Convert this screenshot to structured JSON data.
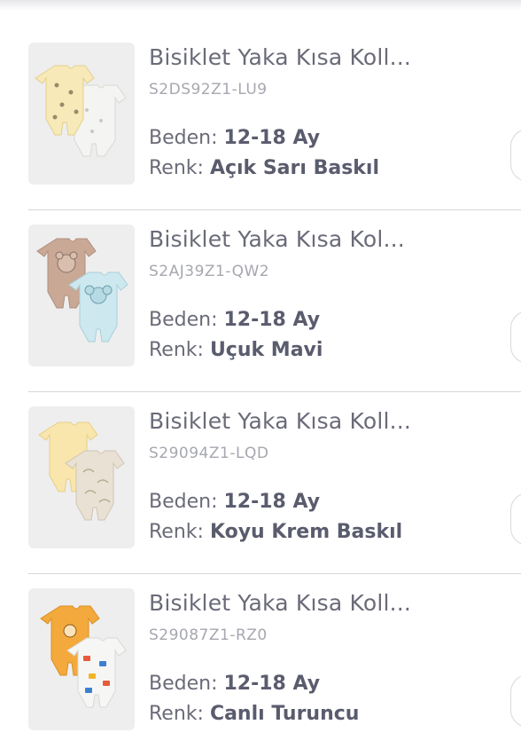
{
  "items": [
    {
      "title": "Bisiklet Yaka Kısa Koll...",
      "code": "S2DS92Z1-LU9",
      "size_label": "Beden:",
      "size_value": "12-18 Ay",
      "color_label": "Renk:",
      "color_value": "Açık Sarı Baskıl",
      "image": "romper-set-yellow-print-icon"
    },
    {
      "title": "Bisiklet Yaka Kısa Kol...",
      "code": "S2AJ39Z1-QW2",
      "size_label": "Beden:",
      "size_value": "12-18 Ay",
      "color_label": "Renk:",
      "color_value": "Uçuk Mavi",
      "image": "romper-set-blue-bear-icon"
    },
    {
      "title": "Bisiklet Yaka Kısa Koll...",
      "code": "S29094Z1-LQD",
      "size_label": "Beden:",
      "size_value": "12-18 Ay",
      "color_label": "Renk:",
      "color_value": "Koyu Krem Baskıl",
      "image": "romper-set-cream-print-icon"
    },
    {
      "title": "Bisiklet Yaka Kısa Koll...",
      "code": "S29087Z1-RZ0",
      "size_label": "Beden:",
      "size_value": "12-18 Ay",
      "color_label": "Renk:",
      "color_value": "Canlı Turuncu",
      "image": "romper-set-orange-print-icon"
    }
  ],
  "colors": {
    "title": "#6a6b78",
    "code": "#a6a7b0",
    "divider": "#d6d6db",
    "thumb_bg": "#eeeeef"
  }
}
